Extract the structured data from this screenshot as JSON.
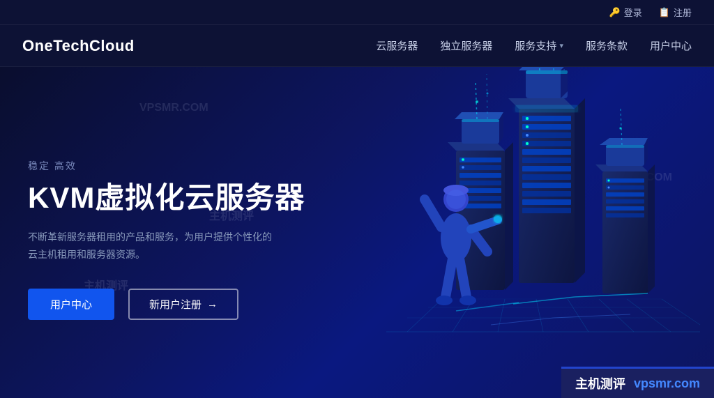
{
  "topbar": {
    "login_label": "登录",
    "register_label": "注册",
    "login_icon": "🔑",
    "register_icon": "📋"
  },
  "navbar": {
    "logo": "OneTechCloud",
    "nav_items": [
      {
        "label": "云服务器",
        "has_dropdown": false
      },
      {
        "label": "独立服务器",
        "has_dropdown": false
      },
      {
        "label": "服务支持",
        "has_dropdown": true
      },
      {
        "label": "服务条款",
        "has_dropdown": false
      },
      {
        "label": "用户中心",
        "has_dropdown": false
      }
    ]
  },
  "hero": {
    "tag": "稳定 高效",
    "title": "KVM虚拟化云服务器",
    "description": "不断革新服务器租用的产品和服务，为用户提供个性化的云主机租用和服务器资源。",
    "btn_primary": "用户中心",
    "btn_outline": "新用户注册",
    "btn_outline_arrow": "→"
  },
  "watermarks": [
    "VPSMR.COM",
    "主机测评",
    "VPSMR.COM",
    "主机测评"
  ],
  "footer_badge": {
    "title": "主机测评",
    "url": "vpsmr.com"
  }
}
